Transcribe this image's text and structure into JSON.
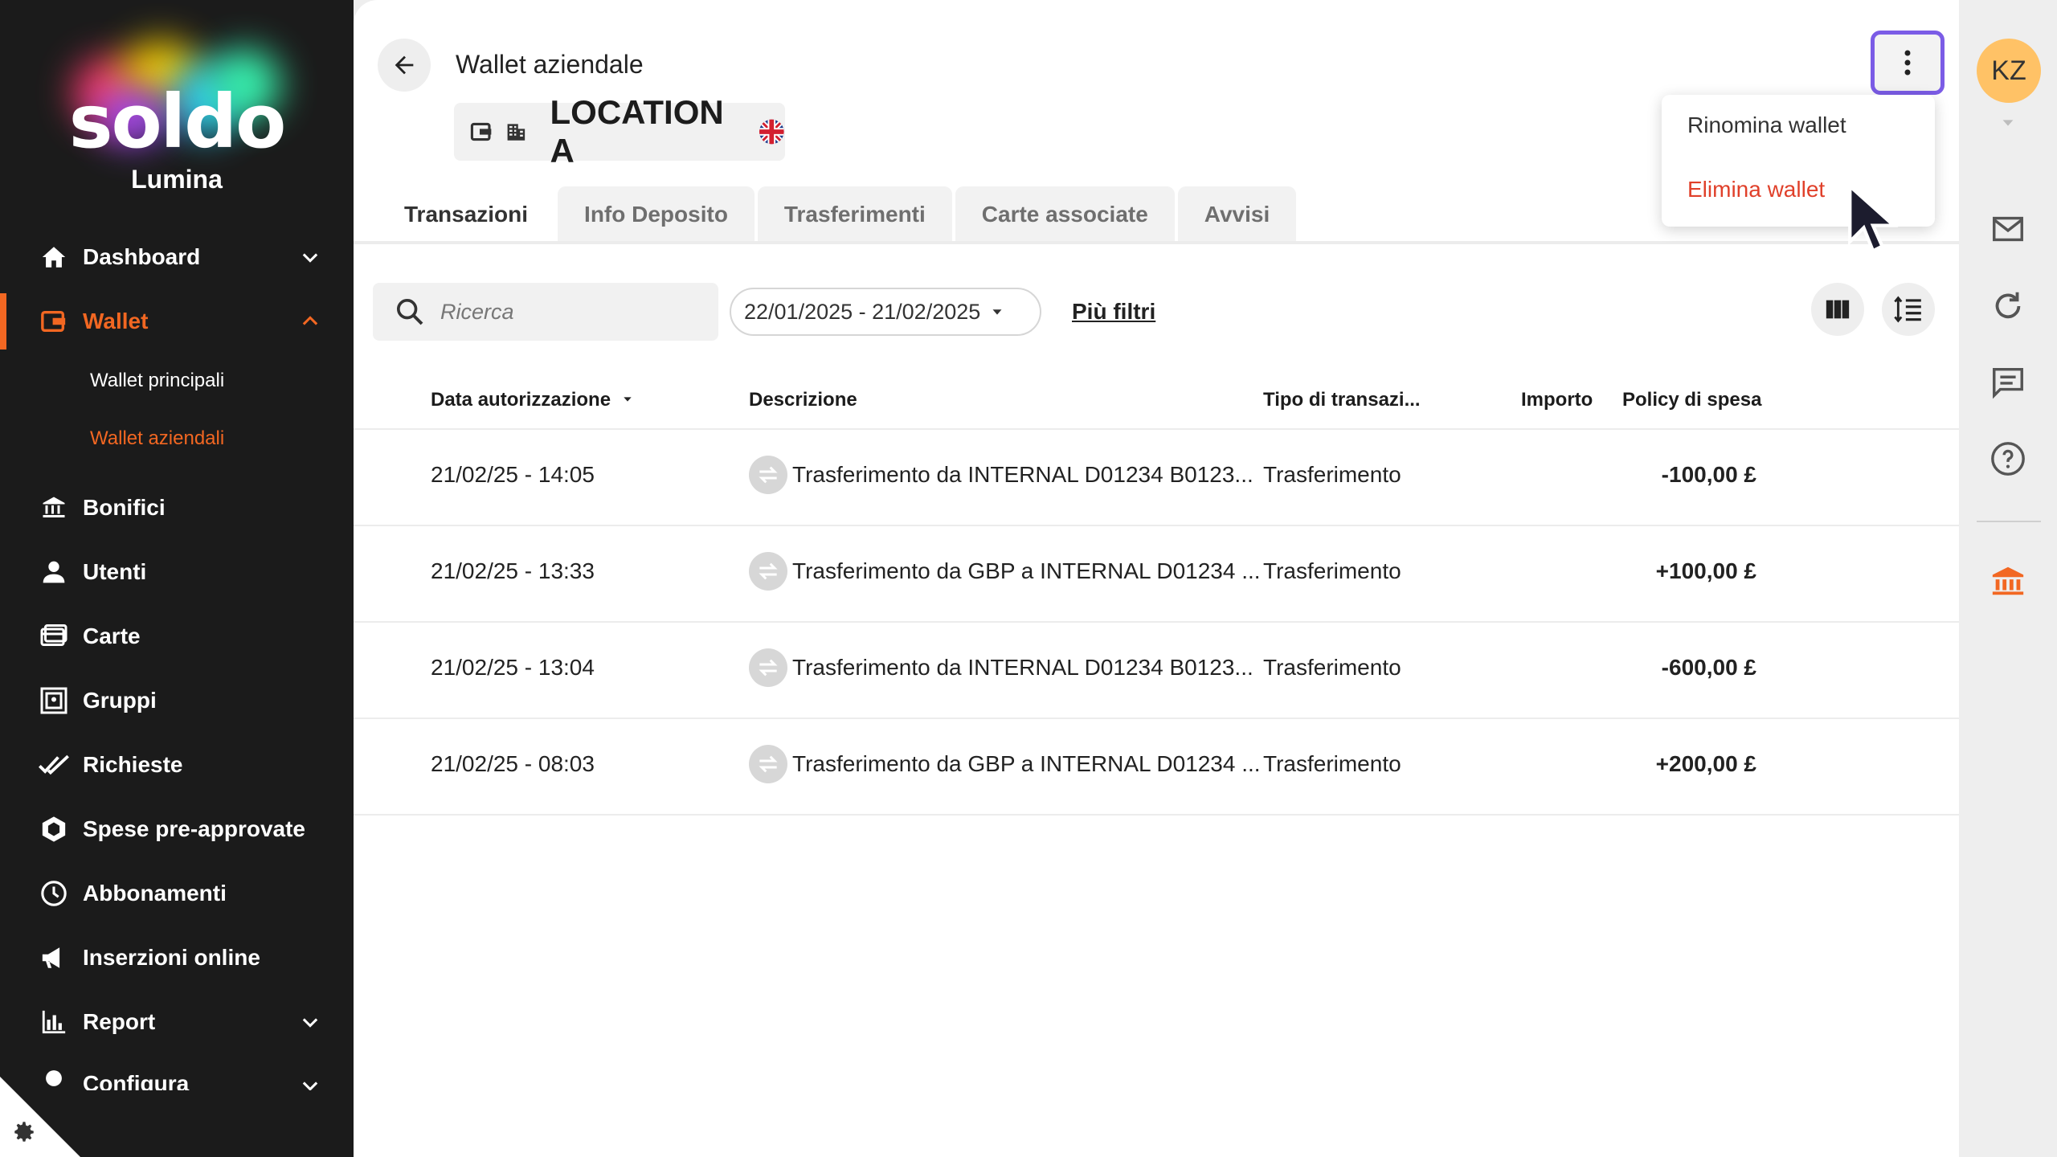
{
  "brand": {
    "logo_text": "soldo",
    "org_name": "Lumina"
  },
  "sidebar": {
    "items": [
      {
        "label": "Dashboard",
        "icon": "home-icon"
      },
      {
        "label": "Wallet",
        "icon": "wallet-icon",
        "active": true
      },
      {
        "label": "Bonifici",
        "icon": "bank-transfer-icon"
      },
      {
        "label": "Utenti",
        "icon": "user-icon"
      },
      {
        "label": "Carte",
        "icon": "card-icon"
      },
      {
        "label": "Gruppi",
        "icon": "groups-icon"
      },
      {
        "label": "Richieste",
        "icon": "double-check-icon"
      },
      {
        "label": "Spese pre-approvate",
        "icon": "hexagon-icon"
      },
      {
        "label": "Abbonamenti",
        "icon": "clock-icon"
      },
      {
        "label": "Inserzioni online",
        "icon": "megaphone-icon"
      },
      {
        "label": "Report",
        "icon": "bar-chart-icon"
      },
      {
        "label": "Configura",
        "icon": "cog-icon"
      }
    ],
    "wallet_sub": [
      {
        "label": "Wallet principali"
      },
      {
        "label": "Wallet aziendali",
        "active": true
      }
    ]
  },
  "header": {
    "title": "Wallet aziendale",
    "wallet_name": "LOCATION A",
    "currency_flag": "uk-flag-icon"
  },
  "tabs": [
    {
      "label": "Transazioni",
      "active": true
    },
    {
      "label": "Info Deposito"
    },
    {
      "label": "Trasferimenti"
    },
    {
      "label": "Carte associate"
    },
    {
      "label": "Avvisi"
    }
  ],
  "filters": {
    "search_placeholder": "Ricerca",
    "date_range": "22/01/2025 - 21/02/2025",
    "more_filters": "Più filtri"
  },
  "table": {
    "columns": [
      "Data autorizzazione",
      "Descrizione",
      "Tipo di transazi...",
      "Importo",
      "Policy di spesa"
    ],
    "rows": [
      {
        "date": "21/02/25 - 14:05",
        "description": "Trasferimento da INTERNAL D01234 B0123...",
        "type": "Trasferimento",
        "amount": "-100,00 £",
        "policy": ""
      },
      {
        "date": "21/02/25 - 13:33",
        "description": "Trasferimento da GBP a INTERNAL D01234 ...",
        "type": "Trasferimento",
        "amount": "+100,00 £",
        "policy": ""
      },
      {
        "date": "21/02/25 - 13:04",
        "description": "Trasferimento da INTERNAL D01234 B0123...",
        "type": "Trasferimento",
        "amount": "-600,00 £",
        "policy": ""
      },
      {
        "date": "21/02/25 - 08:03",
        "description": "Trasferimento da GBP a INTERNAL D01234 ...",
        "type": "Trasferimento",
        "amount": "+200,00 £",
        "policy": ""
      }
    ]
  },
  "menu": {
    "rename": "Rinomina wallet",
    "delete": "Elimina wallet"
  },
  "user": {
    "initials": "KZ"
  },
  "colors": {
    "accent": "#f26722",
    "danger": "#e0402a",
    "focus": "#7b5ce6",
    "avatar": "#ffc266"
  }
}
